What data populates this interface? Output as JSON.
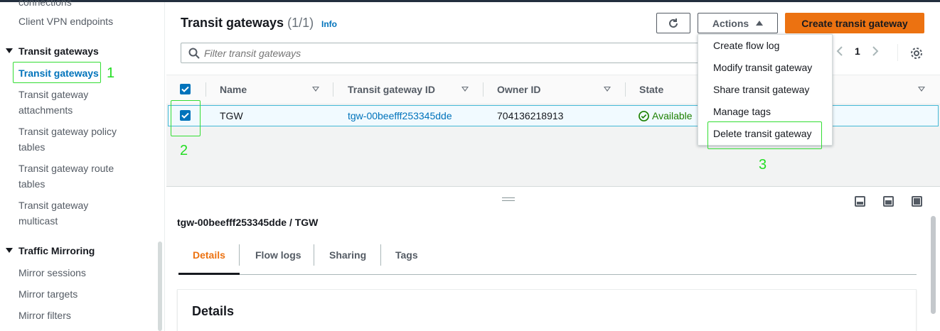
{
  "sidebar": {
    "partial_top": "connections",
    "client_vpn": "Client VPN endpoints",
    "group_transit": "Transit gateways",
    "items_transit": [
      {
        "label": "Transit gateways"
      },
      {
        "label_1": "Transit gateway",
        "label_2": "attachments"
      },
      {
        "label_1": "Transit gateway policy",
        "label_2": "tables"
      },
      {
        "label_1": "Transit gateway route",
        "label_2": "tables"
      },
      {
        "label_1": "Transit gateway",
        "label_2": "multicast"
      }
    ],
    "group_mirror": "Traffic Mirroring",
    "items_mirror": [
      "Mirror sessions",
      "Mirror targets",
      "Mirror filters"
    ]
  },
  "annotations": [
    "1",
    "2",
    "3"
  ],
  "header": {
    "title": "Transit gateways",
    "count": "(1/1)",
    "info": "Info",
    "actions_label": "Actions",
    "create_label": "Create transit gateway"
  },
  "filter": {
    "placeholder": "Filter transit gateways"
  },
  "pager": {
    "page": "1"
  },
  "table": {
    "columns": [
      "Name",
      "Transit gateway ID",
      "Owner ID",
      "State"
    ],
    "rows": [
      {
        "name": "TGW",
        "id": "tgw-00beefff253345dde",
        "owner": "704136218913",
        "state": "Available"
      }
    ]
  },
  "actions_menu": [
    "Create flow log",
    "Modify transit gateway",
    "Share transit gateway",
    "Manage tags",
    "Delete transit gateway"
  ],
  "details": {
    "title": "tgw-00beefff253345dde / TGW",
    "tabs": [
      "Details",
      "Flow logs",
      "Sharing",
      "Tags"
    ],
    "card_title": "Details"
  },
  "colors": {
    "accent": "#ec7211",
    "link": "#0073bb",
    "success": "#1d8102",
    "annotation": "#22dd22"
  }
}
